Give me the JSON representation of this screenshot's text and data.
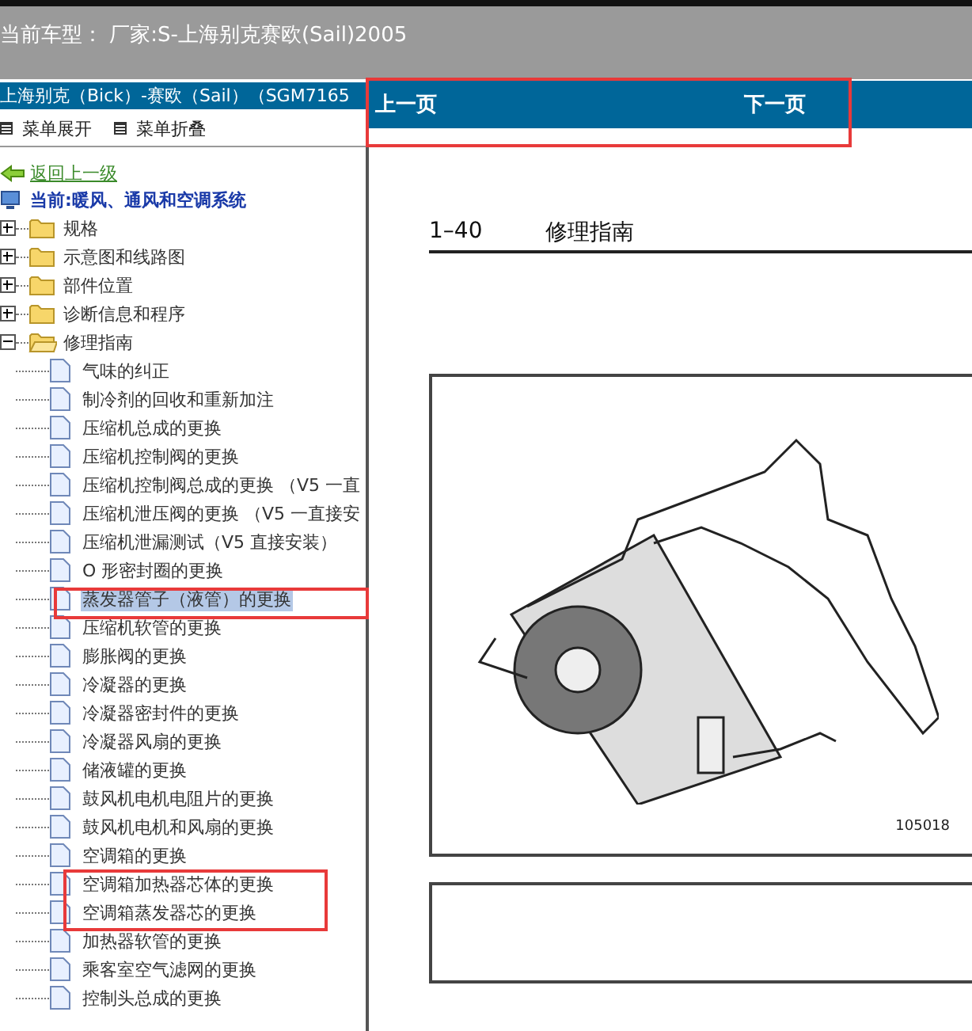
{
  "header": {
    "title": "当前车型：  厂家:S-上海别克赛欧(Sail)2005"
  },
  "sidebar": {
    "title": "上海别克（Bick）-赛欧（Sail）（SGM7165",
    "menu_buttons": [
      "菜单展开",
      "菜单折叠"
    ],
    "back_link": "返回上一级",
    "current": "当前:暖风、通风和空调系统",
    "tree": [
      {
        "label": "规格",
        "expanded": false
      },
      {
        "label": "示意图和线路图",
        "expanded": false
      },
      {
        "label": "部件位置",
        "expanded": false
      },
      {
        "label": "诊断信息和程序",
        "expanded": false
      },
      {
        "label": "修理指南",
        "expanded": true,
        "children": [
          {
            "label": "气味的纠正",
            "selected": false
          },
          {
            "label": "制冷剂的回收和重新加注",
            "selected": false
          },
          {
            "label": "压缩机总成的更换",
            "selected": false
          },
          {
            "label": "压缩机控制阀的更换",
            "selected": false
          },
          {
            "label": "压缩机控制阀总成的更换 （V5 一直",
            "selected": false
          },
          {
            "label": "压缩机泄压阀的更换 （V5 一直接安",
            "selected": false
          },
          {
            "label": "压缩机泄漏测试（V5 直接安装）",
            "selected": false
          },
          {
            "label": "O 形密封圈的更换",
            "selected": false
          },
          {
            "label": "蒸发器管子（液管）的更换",
            "selected": true
          },
          {
            "label": "压缩机软管的更换",
            "selected": false
          },
          {
            "label": "膨胀阀的更换",
            "selected": false
          },
          {
            "label": "冷凝器的更换",
            "selected": false
          },
          {
            "label": "冷凝器密封件的更换",
            "selected": false
          },
          {
            "label": "冷凝器风扇的更换",
            "selected": false
          },
          {
            "label": "储液罐的更换",
            "selected": false
          },
          {
            "label": "鼓风机电机电阻片的更换",
            "selected": false
          },
          {
            "label": "鼓风机电机和风扇的更换",
            "selected": false
          },
          {
            "label": "空调箱的更换",
            "selected": false
          },
          {
            "label": "空调箱加热器芯体的更换",
            "selected": false
          },
          {
            "label": "空调箱蒸发器芯的更换",
            "selected": false
          },
          {
            "label": "加热器软管的更换",
            "selected": false
          },
          {
            "label": "乘客室空气滤网的更换",
            "selected": false
          },
          {
            "label": "控制头总成的更换",
            "selected": false
          }
        ]
      }
    ]
  },
  "document": {
    "nav": [
      "上一页",
      "下一页"
    ],
    "page_number": "1–40",
    "section": "修理指南",
    "figure_id": "105018"
  }
}
